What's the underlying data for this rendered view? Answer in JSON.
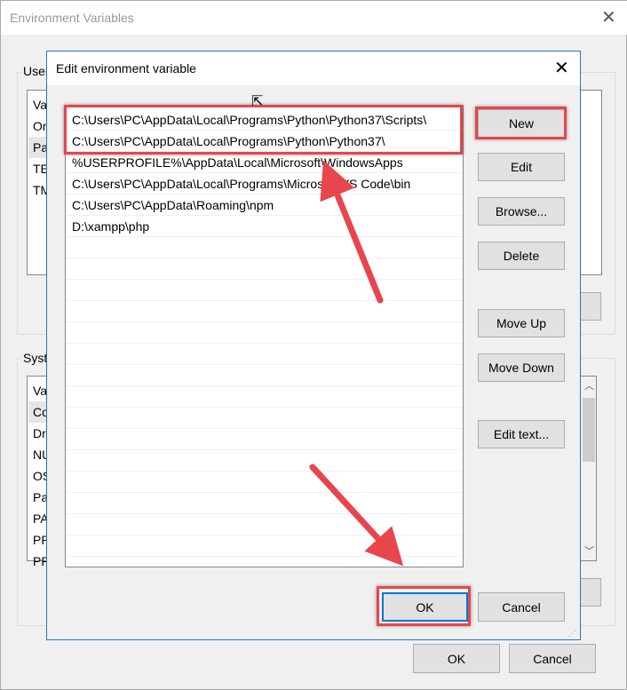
{
  "outer": {
    "title": "Environment Variables",
    "user_group": "User",
    "user_items": [
      "Va",
      "On",
      "Pa",
      "TE",
      "TM"
    ],
    "system_group": "Syste",
    "system_items": [
      "Va",
      "Co",
      "Dr",
      "NU",
      "OS",
      "Pa",
      "PA",
      "PR",
      "PR"
    ],
    "ok": "OK",
    "cancel": "Cancel"
  },
  "dialog": {
    "title": "Edit environment variable",
    "entries": [
      "C:\\Users\\PC\\AppData\\Local\\Programs\\Python\\Python37\\Scripts\\",
      "C:\\Users\\PC\\AppData\\Local\\Programs\\Python\\Python37\\",
      "%USERPROFILE%\\AppData\\Local\\Microsoft\\WindowsApps",
      "C:\\Users\\PC\\AppData\\Local\\Programs\\Microsoft VS Code\\bin",
      "C:\\Users\\PC\\AppData\\Roaming\\npm",
      "D:\\xampp\\php"
    ],
    "buttons": {
      "new": "New",
      "edit": "Edit",
      "browse": "Browse...",
      "delete": "Delete",
      "move_up": "Move Up",
      "move_down": "Move Down",
      "edit_text": "Edit text..."
    },
    "ok": "OK",
    "cancel": "Cancel"
  },
  "colors": {
    "highlight": "#e8454c",
    "accent": "#0078d7"
  }
}
